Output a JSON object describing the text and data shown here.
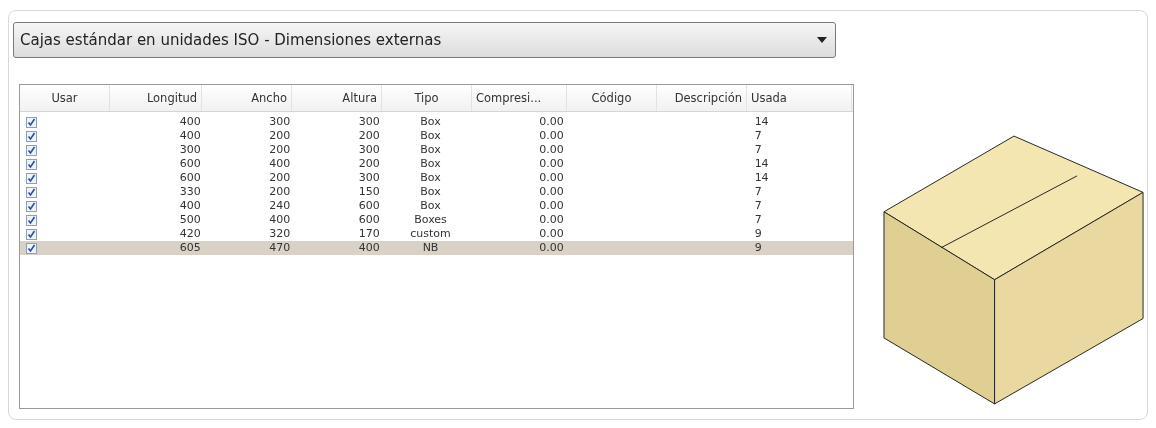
{
  "dropdown": {
    "value": "Cajas estándar en unidades ISO - Dimensiones externas"
  },
  "table": {
    "columns": [
      "Usar",
      "Longitud",
      "Ancho",
      "Altura",
      "Tipo",
      "Compresi...",
      "Código",
      "Descripción",
      "Usada"
    ],
    "rows": [
      {
        "checked": true,
        "selected": false,
        "cells": [
          "",
          "400",
          "300",
          "300",
          "Box",
          "0.00",
          "",
          "",
          "14"
        ]
      },
      {
        "checked": true,
        "selected": false,
        "cells": [
          "",
          "400",
          "200",
          "200",
          "Box",
          "0.00",
          "",
          "",
          "7"
        ]
      },
      {
        "checked": true,
        "selected": false,
        "cells": [
          "",
          "300",
          "200",
          "300",
          "Box",
          "0.00",
          "",
          "",
          "7"
        ]
      },
      {
        "checked": true,
        "selected": false,
        "cells": [
          "",
          "600",
          "400",
          "200",
          "Box",
          "0.00",
          "",
          "",
          "14"
        ]
      },
      {
        "checked": true,
        "selected": false,
        "cells": [
          "",
          "600",
          "200",
          "300",
          "Box",
          "0.00",
          "",
          "",
          "14"
        ]
      },
      {
        "checked": true,
        "selected": false,
        "cells": [
          "",
          "330",
          "200",
          "150",
          "Box",
          "0.00",
          "",
          "",
          "7"
        ]
      },
      {
        "checked": true,
        "selected": false,
        "cells": [
          "",
          "400",
          "240",
          "600",
          "Box",
          "0.00",
          "",
          "",
          "7"
        ]
      },
      {
        "checked": true,
        "selected": false,
        "cells": [
          "",
          "500",
          "400",
          "600",
          "Boxes",
          "0.00",
          "",
          "",
          "7"
        ]
      },
      {
        "checked": true,
        "selected": false,
        "cells": [
          "",
          "420",
          "320",
          "170",
          "custom",
          "0.00",
          "",
          "",
          "9"
        ]
      },
      {
        "checked": true,
        "selected": true,
        "cells": [
          "",
          "605",
          "470",
          "400",
          "NB",
          "0.00",
          "",
          "",
          "9"
        ]
      }
    ]
  }
}
